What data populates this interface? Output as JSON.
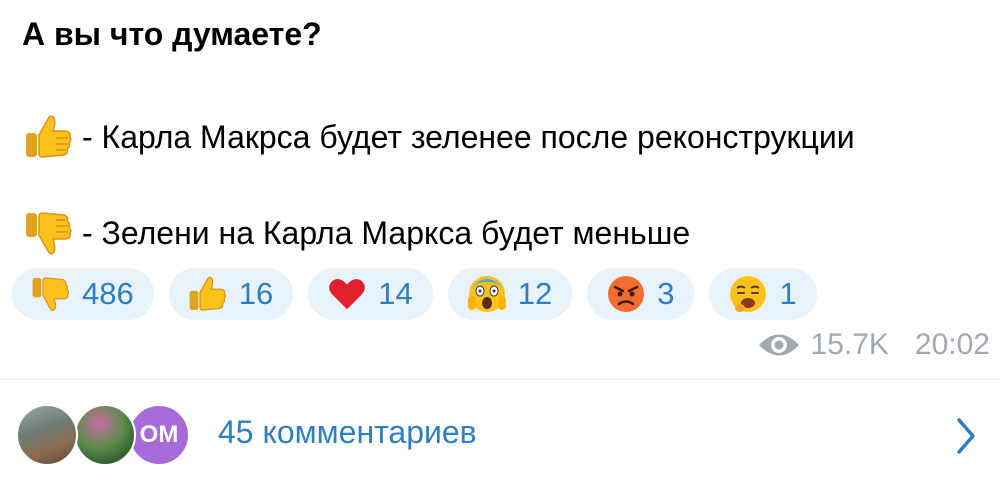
{
  "post": {
    "headline": "А вы что думаете?",
    "options": [
      {
        "icon": "thumbs-up-icon",
        "text": "- Карла Макрса будет зеленее после реконструкции"
      },
      {
        "icon": "thumbs-down-icon",
        "text": "- Зелени на Карла Маркса будет меньше"
      }
    ]
  },
  "reactions": [
    {
      "icon": "thumbs-down-icon",
      "count": "486"
    },
    {
      "icon": "thumbs-up-icon",
      "count": "16"
    },
    {
      "icon": "red-heart-icon",
      "count": "14"
    },
    {
      "icon": "screaming-face-icon",
      "count": "12"
    },
    {
      "icon": "angry-face-icon",
      "count": "3"
    },
    {
      "icon": "nauseated-face-icon",
      "count": "1"
    }
  ],
  "meta": {
    "views": "15.7K",
    "time": "20:02"
  },
  "comments": {
    "label": "45 комментариев",
    "avatar_initials": "OM"
  },
  "colors": {
    "accent": "#2e7ec0",
    "reaction_bg": "#e7f2fb",
    "meta_gray": "#a2a8ae",
    "avatar_purple": "#a66ad9"
  }
}
